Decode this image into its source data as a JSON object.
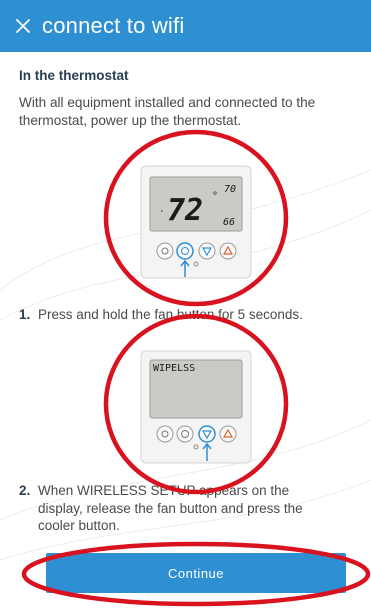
{
  "header": {
    "title": "connect to wifi",
    "close_icon": "close-icon",
    "background": "#2e8fd3"
  },
  "section": {
    "heading": "In the thermostat",
    "intro": "With all equipment installed and connected to the thermostat, power up the thermostat."
  },
  "thermostat_1": {
    "temperature": "72",
    "degree": "°",
    "setpoint_high": "70",
    "setpoint_low": "66"
  },
  "step1": {
    "number": "1.",
    "text": "Press and hold the fan button for 5 seconds."
  },
  "thermostat_2": {
    "display_text": "WIPELSS"
  },
  "step2": {
    "number": "2.",
    "text": "When WIRELESS SETUP appears on the display, release the fan button and press the cooler button."
  },
  "continue_button": {
    "label": "Continue"
  },
  "colors": {
    "accent": "#2e8fd3",
    "annotation_red": "#d9121f"
  }
}
